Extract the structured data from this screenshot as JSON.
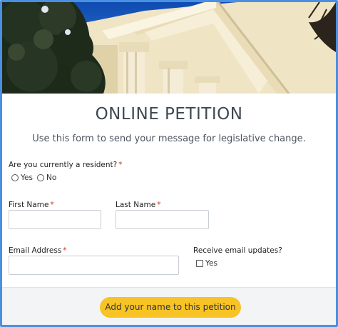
{
  "form": {
    "title": "ONLINE PETITION",
    "subtitle": "Use this form to send your message for legislative change."
  },
  "resident": {
    "label": "Are you currently a resident?",
    "required_mark": "*",
    "options": [
      "Yes",
      "No"
    ]
  },
  "first_name": {
    "label": "First Name",
    "required_mark": "*",
    "value": ""
  },
  "last_name": {
    "label": "Last Name",
    "required_mark": "*",
    "value": ""
  },
  "email": {
    "label": "Email Address",
    "required_mark": "*",
    "value": ""
  },
  "updates": {
    "label": "Receive email updates?",
    "option": "Yes"
  },
  "submit": {
    "label": "Add your name to this petition"
  },
  "colors": {
    "frame_border": "#4a90e2",
    "button": "#f7c325",
    "required": "#d22f27",
    "sky": "#1f5cc0"
  },
  "icons": {
    "hero": "building-photo"
  }
}
